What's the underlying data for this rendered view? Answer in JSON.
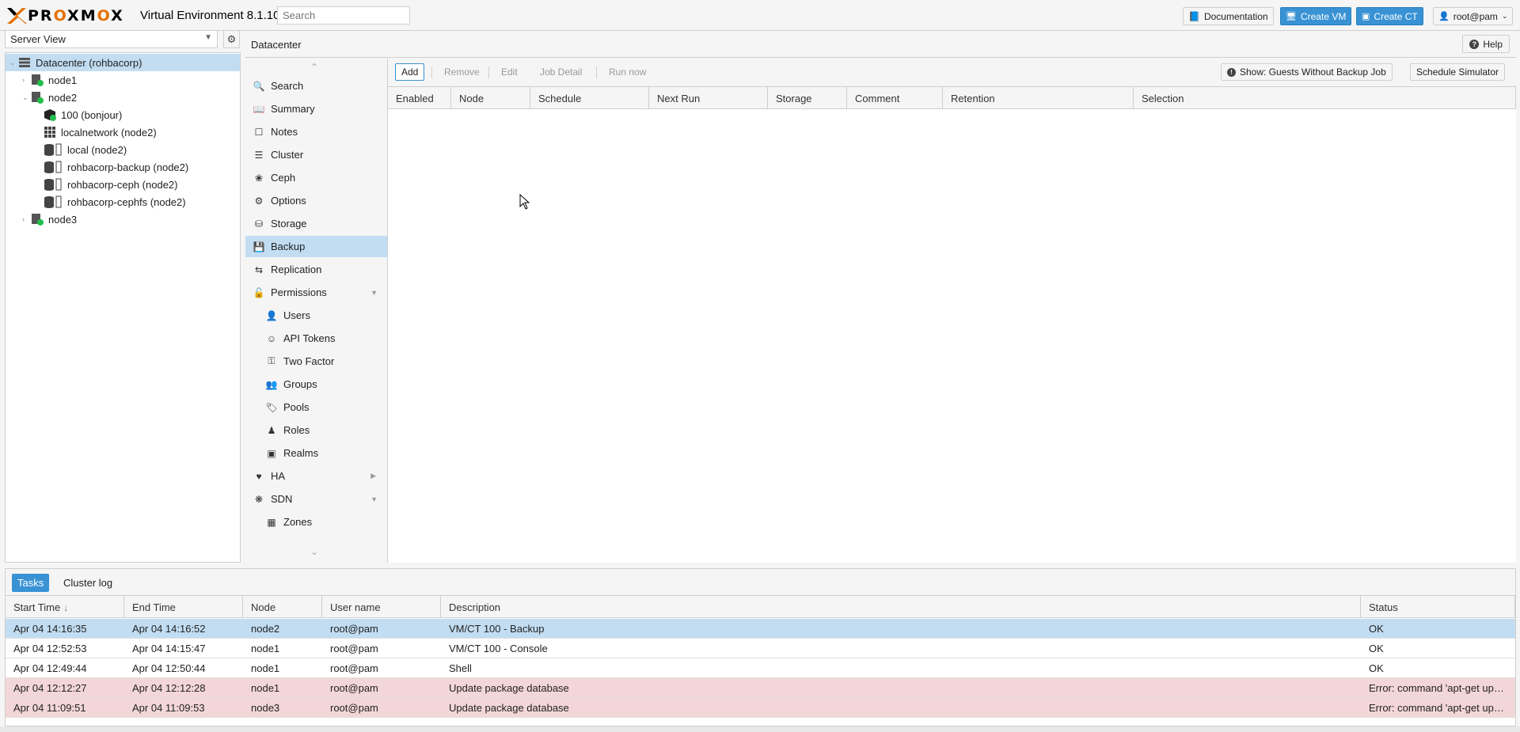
{
  "header": {
    "logo_text": "PROXMOX",
    "version_text": "Virtual Environment 8.1.10",
    "search_placeholder": "Search",
    "buttons": {
      "documentation": "Documentation",
      "create_vm": "Create VM",
      "create_ct": "Create CT",
      "user": "root@pam"
    }
  },
  "tree": {
    "view_select": "Server View",
    "items": [
      {
        "label": "Datacenter (rohbacorp)",
        "icon": "datacenter-icon"
      },
      {
        "label": "node1",
        "icon": "node-online-icon"
      },
      {
        "label": "node2",
        "icon": "node-online-icon"
      },
      {
        "label": "100 (bonjour)",
        "icon": "vm-running-icon"
      },
      {
        "label": "localnetwork (node2)",
        "icon": "network-grid-icon"
      },
      {
        "label": "local (node2)",
        "icon": "storage-icon"
      },
      {
        "label": "rohbacorp-backup (node2)",
        "icon": "storage-icon"
      },
      {
        "label": "rohbacorp-ceph (node2)",
        "icon": "storage-icon"
      },
      {
        "label": "rohbacorp-cephfs (node2)",
        "icon": "storage-icon"
      },
      {
        "label": "node3",
        "icon": "node-online-icon"
      }
    ]
  },
  "content": {
    "title": "Datacenter",
    "help_label": "Help"
  },
  "menu": {
    "items": [
      {
        "label": "Search",
        "icon": "search-icon"
      },
      {
        "label": "Summary",
        "icon": "book-icon"
      },
      {
        "label": "Notes",
        "icon": "notes-icon"
      },
      {
        "label": "Cluster",
        "icon": "server-icon"
      },
      {
        "label": "Ceph",
        "icon": "ceph-icon"
      },
      {
        "label": "Options",
        "icon": "gear-icon"
      },
      {
        "label": "Storage",
        "icon": "database-icon"
      },
      {
        "label": "Backup",
        "icon": "floppy-icon"
      },
      {
        "label": "Replication",
        "icon": "retweet-icon"
      },
      {
        "label": "Permissions",
        "icon": "unlock-icon"
      },
      {
        "label": "Users",
        "icon": "user-icon"
      },
      {
        "label": "API Tokens",
        "icon": "user-outline-icon"
      },
      {
        "label": "Two Factor",
        "icon": "key-icon"
      },
      {
        "label": "Groups",
        "icon": "users-icon"
      },
      {
        "label": "Pools",
        "icon": "tags-icon"
      },
      {
        "label": "Roles",
        "icon": "male-icon"
      },
      {
        "label": "Realms",
        "icon": "address-book-icon"
      },
      {
        "label": "HA",
        "icon": "heartbeat-icon"
      },
      {
        "label": "SDN",
        "icon": "sdn-icon"
      },
      {
        "label": "Zones",
        "icon": "th-icon"
      }
    ]
  },
  "backup": {
    "toolbar": {
      "add": "Add",
      "remove": "Remove",
      "edit": "Edit",
      "job_detail": "Job Detail",
      "run_now": "Run now",
      "show_guests": "Show: Guests Without Backup Job",
      "schedule_simulator": "Schedule Simulator"
    },
    "columns": [
      "Enabled",
      "Node",
      "Schedule",
      "Next Run",
      "Storage",
      "Comment",
      "Retention",
      "Selection"
    ]
  },
  "tasks": {
    "tabs": [
      "Tasks",
      "Cluster log"
    ],
    "columns": [
      "Start Time",
      "End Time",
      "Node",
      "User name",
      "Description",
      "Status"
    ],
    "rows": [
      {
        "start": "Apr 04 14:16:35",
        "end": "Apr 04 14:16:52",
        "node": "node2",
        "user": "root@pam",
        "desc": "VM/CT 100 - Backup",
        "status": "OK"
      },
      {
        "start": "Apr 04 12:52:53",
        "end": "Apr 04 14:15:47",
        "node": "node1",
        "user": "root@pam",
        "desc": "VM/CT 100 - Console",
        "status": "OK"
      },
      {
        "start": "Apr 04 12:49:44",
        "end": "Apr 04 12:50:44",
        "node": "node1",
        "user": "root@pam",
        "desc": "Shell",
        "status": "OK"
      },
      {
        "start": "Apr 04 12:12:27",
        "end": "Apr 04 12:12:28",
        "node": "node1",
        "user": "root@pam",
        "desc": "Update package database",
        "status": "Error: command 'apt-get upd..."
      },
      {
        "start": "Apr 04 11:09:51",
        "end": "Apr 04 11:09:53",
        "node": "node3",
        "user": "root@pam",
        "desc": "Update package database",
        "status": "Error: command 'apt-get upd..."
      }
    ]
  },
  "colors": {
    "accent": "#3892d4",
    "selected": "#c2ddf2",
    "error_row": "#f3d6d7",
    "logo_orange": "#e57000",
    "online_green": "#21bf4b"
  }
}
